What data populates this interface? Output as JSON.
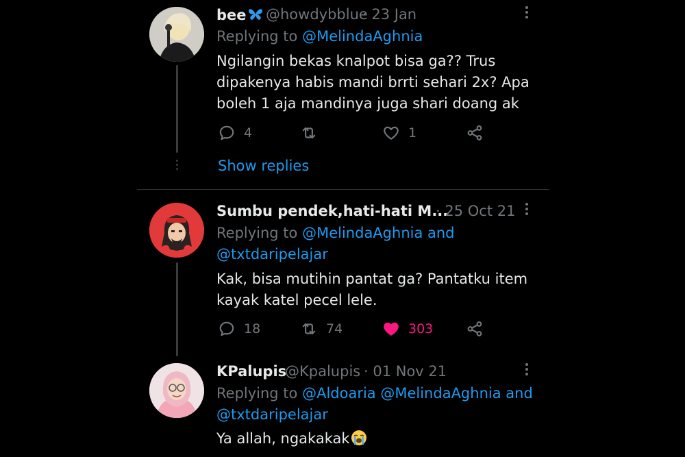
{
  "tweets": [
    {
      "display_name": "bee",
      "name_emoji": "butterfly",
      "handle": "@howdybblue",
      "date": "· 23 Jan",
      "replying_prefix": "Replying to",
      "replying_line1": "@MelindaAghnia",
      "replying_line2": "",
      "text": "Ngilangin bekas knalpot bisa ga?? Trus dipakenya habis mandi brrti sehari 2x?  Apa boleh 1 aja mandinya juga shari doang ak",
      "replies": "4",
      "retweets": "",
      "likes": "1",
      "liked": false,
      "show_replies": "Show replies"
    },
    {
      "display_name": "Sumbu pendek,hati-hati M...",
      "handle": "",
      "date": "· 25 Oct 21",
      "replying_prefix": "Replying to",
      "replying_line1": "@MelindaAghnia and",
      "replying_line2": "@txtdaripelajar",
      "text": "Kak, bisa mutihin pantat ga? Pantatku item kayak katel pecel lele.",
      "replies": "18",
      "retweets": "74",
      "likes": "303",
      "liked": true
    },
    {
      "display_name": "KPalupis",
      "handle": "@Kpalupis",
      "date": "· 01 Nov 21",
      "replying_prefix": "Replying to",
      "replying_line1": "@Aldoaria @MelindaAghnia and",
      "replying_line2": "@txtdaripelajar",
      "text": "Ya allah, ngakakak",
      "text_emoji": "loudly-crying-face"
    }
  ],
  "colors": {
    "background": "#000000",
    "text": "#e7e9ea",
    "muted": "#71767b",
    "link": "#1d9bf0",
    "like_active": "#f91880"
  }
}
